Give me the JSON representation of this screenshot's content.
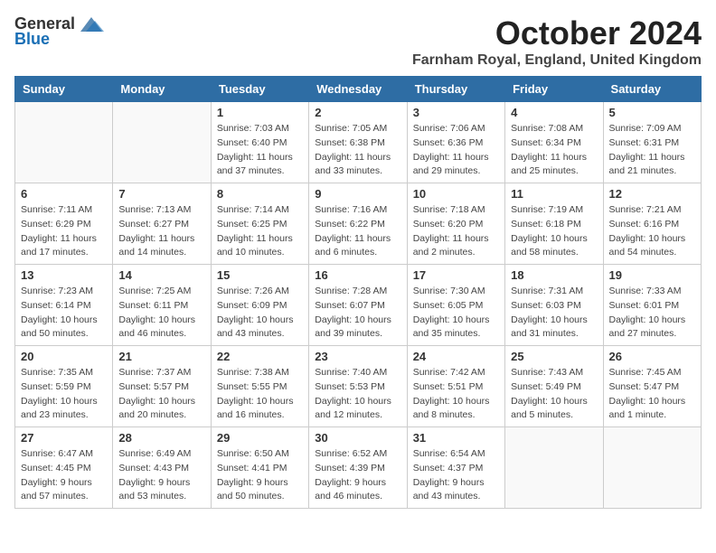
{
  "logo": {
    "general": "General",
    "blue": "Blue"
  },
  "title": "October 2024",
  "location": "Farnham Royal, England, United Kingdom",
  "days_of_week": [
    "Sunday",
    "Monday",
    "Tuesday",
    "Wednesday",
    "Thursday",
    "Friday",
    "Saturday"
  ],
  "weeks": [
    [
      {
        "day": "",
        "sunrise": "",
        "sunset": "",
        "daylight": ""
      },
      {
        "day": "",
        "sunrise": "",
        "sunset": "",
        "daylight": ""
      },
      {
        "day": "1",
        "sunrise": "Sunrise: 7:03 AM",
        "sunset": "Sunset: 6:40 PM",
        "daylight": "Daylight: 11 hours and 37 minutes."
      },
      {
        "day": "2",
        "sunrise": "Sunrise: 7:05 AM",
        "sunset": "Sunset: 6:38 PM",
        "daylight": "Daylight: 11 hours and 33 minutes."
      },
      {
        "day": "3",
        "sunrise": "Sunrise: 7:06 AM",
        "sunset": "Sunset: 6:36 PM",
        "daylight": "Daylight: 11 hours and 29 minutes."
      },
      {
        "day": "4",
        "sunrise": "Sunrise: 7:08 AM",
        "sunset": "Sunset: 6:34 PM",
        "daylight": "Daylight: 11 hours and 25 minutes."
      },
      {
        "day": "5",
        "sunrise": "Sunrise: 7:09 AM",
        "sunset": "Sunset: 6:31 PM",
        "daylight": "Daylight: 11 hours and 21 minutes."
      }
    ],
    [
      {
        "day": "6",
        "sunrise": "Sunrise: 7:11 AM",
        "sunset": "Sunset: 6:29 PM",
        "daylight": "Daylight: 11 hours and 17 minutes."
      },
      {
        "day": "7",
        "sunrise": "Sunrise: 7:13 AM",
        "sunset": "Sunset: 6:27 PM",
        "daylight": "Daylight: 11 hours and 14 minutes."
      },
      {
        "day": "8",
        "sunrise": "Sunrise: 7:14 AM",
        "sunset": "Sunset: 6:25 PM",
        "daylight": "Daylight: 11 hours and 10 minutes."
      },
      {
        "day": "9",
        "sunrise": "Sunrise: 7:16 AM",
        "sunset": "Sunset: 6:22 PM",
        "daylight": "Daylight: 11 hours and 6 minutes."
      },
      {
        "day": "10",
        "sunrise": "Sunrise: 7:18 AM",
        "sunset": "Sunset: 6:20 PM",
        "daylight": "Daylight: 11 hours and 2 minutes."
      },
      {
        "day": "11",
        "sunrise": "Sunrise: 7:19 AM",
        "sunset": "Sunset: 6:18 PM",
        "daylight": "Daylight: 10 hours and 58 minutes."
      },
      {
        "day": "12",
        "sunrise": "Sunrise: 7:21 AM",
        "sunset": "Sunset: 6:16 PM",
        "daylight": "Daylight: 10 hours and 54 minutes."
      }
    ],
    [
      {
        "day": "13",
        "sunrise": "Sunrise: 7:23 AM",
        "sunset": "Sunset: 6:14 PM",
        "daylight": "Daylight: 10 hours and 50 minutes."
      },
      {
        "day": "14",
        "sunrise": "Sunrise: 7:25 AM",
        "sunset": "Sunset: 6:11 PM",
        "daylight": "Daylight: 10 hours and 46 minutes."
      },
      {
        "day": "15",
        "sunrise": "Sunrise: 7:26 AM",
        "sunset": "Sunset: 6:09 PM",
        "daylight": "Daylight: 10 hours and 43 minutes."
      },
      {
        "day": "16",
        "sunrise": "Sunrise: 7:28 AM",
        "sunset": "Sunset: 6:07 PM",
        "daylight": "Daylight: 10 hours and 39 minutes."
      },
      {
        "day": "17",
        "sunrise": "Sunrise: 7:30 AM",
        "sunset": "Sunset: 6:05 PM",
        "daylight": "Daylight: 10 hours and 35 minutes."
      },
      {
        "day": "18",
        "sunrise": "Sunrise: 7:31 AM",
        "sunset": "Sunset: 6:03 PM",
        "daylight": "Daylight: 10 hours and 31 minutes."
      },
      {
        "day": "19",
        "sunrise": "Sunrise: 7:33 AM",
        "sunset": "Sunset: 6:01 PM",
        "daylight": "Daylight: 10 hours and 27 minutes."
      }
    ],
    [
      {
        "day": "20",
        "sunrise": "Sunrise: 7:35 AM",
        "sunset": "Sunset: 5:59 PM",
        "daylight": "Daylight: 10 hours and 23 minutes."
      },
      {
        "day": "21",
        "sunrise": "Sunrise: 7:37 AM",
        "sunset": "Sunset: 5:57 PM",
        "daylight": "Daylight: 10 hours and 20 minutes."
      },
      {
        "day": "22",
        "sunrise": "Sunrise: 7:38 AM",
        "sunset": "Sunset: 5:55 PM",
        "daylight": "Daylight: 10 hours and 16 minutes."
      },
      {
        "day": "23",
        "sunrise": "Sunrise: 7:40 AM",
        "sunset": "Sunset: 5:53 PM",
        "daylight": "Daylight: 10 hours and 12 minutes."
      },
      {
        "day": "24",
        "sunrise": "Sunrise: 7:42 AM",
        "sunset": "Sunset: 5:51 PM",
        "daylight": "Daylight: 10 hours and 8 minutes."
      },
      {
        "day": "25",
        "sunrise": "Sunrise: 7:43 AM",
        "sunset": "Sunset: 5:49 PM",
        "daylight": "Daylight: 10 hours and 5 minutes."
      },
      {
        "day": "26",
        "sunrise": "Sunrise: 7:45 AM",
        "sunset": "Sunset: 5:47 PM",
        "daylight": "Daylight: 10 hours and 1 minute."
      }
    ],
    [
      {
        "day": "27",
        "sunrise": "Sunrise: 6:47 AM",
        "sunset": "Sunset: 4:45 PM",
        "daylight": "Daylight: 9 hours and 57 minutes."
      },
      {
        "day": "28",
        "sunrise": "Sunrise: 6:49 AM",
        "sunset": "Sunset: 4:43 PM",
        "daylight": "Daylight: 9 hours and 53 minutes."
      },
      {
        "day": "29",
        "sunrise": "Sunrise: 6:50 AM",
        "sunset": "Sunset: 4:41 PM",
        "daylight": "Daylight: 9 hours and 50 minutes."
      },
      {
        "day": "30",
        "sunrise": "Sunrise: 6:52 AM",
        "sunset": "Sunset: 4:39 PM",
        "daylight": "Daylight: 9 hours and 46 minutes."
      },
      {
        "day": "31",
        "sunrise": "Sunrise: 6:54 AM",
        "sunset": "Sunset: 4:37 PM",
        "daylight": "Daylight: 9 hours and 43 minutes."
      },
      {
        "day": "",
        "sunrise": "",
        "sunset": "",
        "daylight": ""
      },
      {
        "day": "",
        "sunrise": "",
        "sunset": "",
        "daylight": ""
      }
    ]
  ]
}
